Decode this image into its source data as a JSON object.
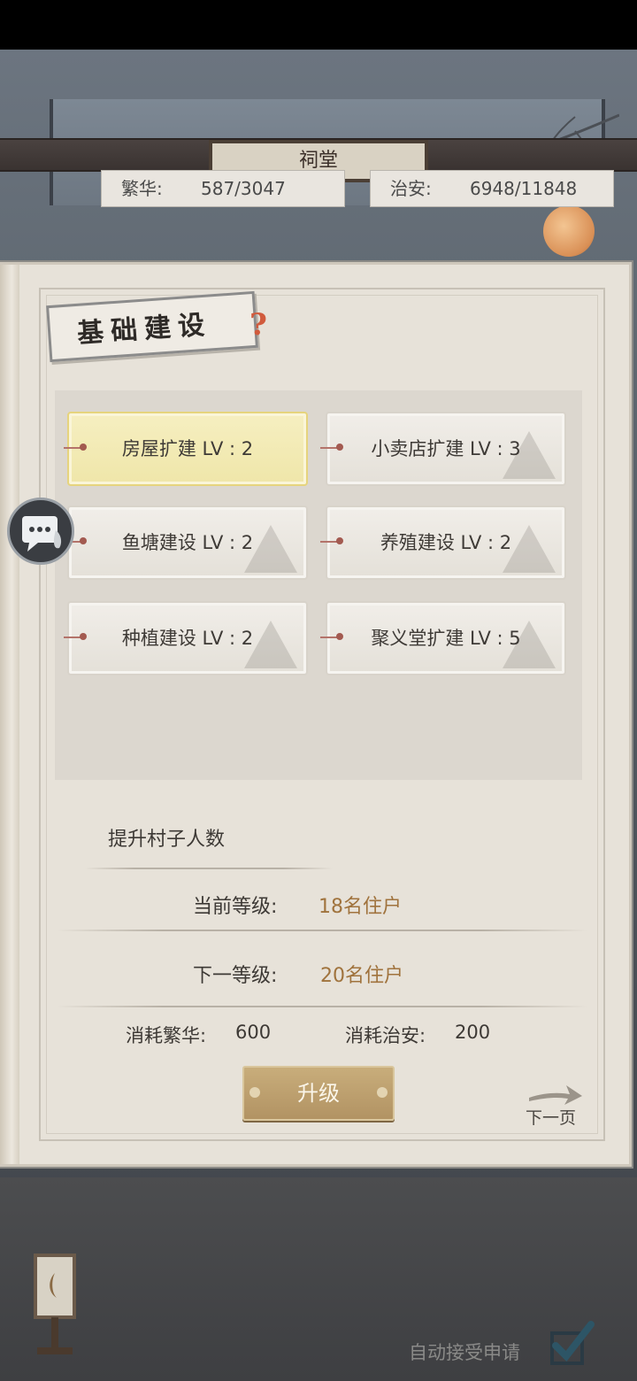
{
  "background": {
    "sign_text": "祠堂"
  },
  "stats": {
    "prosperity": {
      "label": "繁华:",
      "value": "587/3047"
    },
    "security": {
      "label": "治安:",
      "value": "6948/11848"
    }
  },
  "panel": {
    "title": "基础建设",
    "help_symbol": "?"
  },
  "buildings": [
    {
      "label": "房屋扩建 LV : 2",
      "selected": true
    },
    {
      "label": "小卖店扩建 LV : 3",
      "selected": false
    },
    {
      "label": "鱼塘建设 LV : 2",
      "selected": false
    },
    {
      "label": "养殖建设 LV : 2",
      "selected": false
    },
    {
      "label": "种植建设 LV : 2",
      "selected": false
    },
    {
      "label": "聚义堂扩建 LV : 5",
      "selected": false
    }
  ],
  "detail": {
    "description": "提升村子人数",
    "current_level_label": "当前等级:",
    "current_level_value": "18名住户",
    "next_level_label": "下一等级:",
    "next_level_value": "20名住户",
    "cost_prosperity_label": "消耗繁华:",
    "cost_prosperity_value": "600",
    "cost_security_label": "消耗治安:",
    "cost_security_value": "200",
    "upgrade_label": "升级",
    "next_page_label": "下一页"
  },
  "bottom": {
    "auto_accept_label": "自动接受申请",
    "auto_accept_checked": true
  },
  "colors": {
    "accent_gold": "#b29363",
    "value_text": "#a0733d",
    "selected_tile": "#f6efc1"
  }
}
